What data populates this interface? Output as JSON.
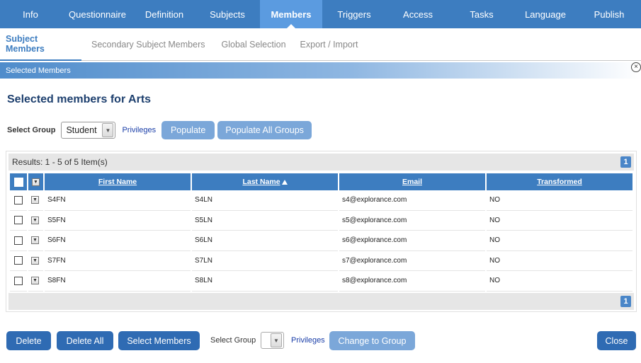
{
  "topnav": {
    "tabs": [
      {
        "label": "Info"
      },
      {
        "label": "Questionnaire"
      },
      {
        "label": "Definition"
      },
      {
        "label": "Subjects"
      },
      {
        "label": "Members"
      },
      {
        "label": "Triggers"
      },
      {
        "label": "Access"
      },
      {
        "label": "Tasks"
      },
      {
        "label": "Language"
      },
      {
        "label": "Publish"
      }
    ],
    "active": "Members"
  },
  "subnav": {
    "tabs": [
      {
        "label": "Subject Members"
      },
      {
        "label": "Secondary Subject Members"
      },
      {
        "label": "Global Selection"
      },
      {
        "label": "Export / Import"
      }
    ],
    "active": "Subject Members"
  },
  "section": {
    "title": "Selected Members"
  },
  "page": {
    "heading": "Selected members for Arts"
  },
  "toolbar": {
    "select_group_label": "Select Group",
    "group_value": "Student",
    "privileges_label": "Privileges",
    "populate_label": "Populate",
    "populate_all_label": "Populate All Groups"
  },
  "grid": {
    "results_text": "Results: 1 - 5 of 5 Item(s)",
    "page_number": "1",
    "columns": [
      "First Name",
      "Last Name",
      "Email",
      "Transformed"
    ],
    "sorted_column": "Last Name",
    "rows": [
      {
        "first": "S4FN",
        "last": "S4LN",
        "email": "s4@explorance.com",
        "transformed": "NO"
      },
      {
        "first": "S5FN",
        "last": "S5LN",
        "email": "s5@explorance.com",
        "transformed": "NO"
      },
      {
        "first": "S6FN",
        "last": "S6LN",
        "email": "s6@explorance.com",
        "transformed": "NO"
      },
      {
        "first": "S7FN",
        "last": "S7LN",
        "email": "s7@explorance.com",
        "transformed": "NO"
      },
      {
        "first": "S8FN",
        "last": "S8LN",
        "email": "s8@explorance.com",
        "transformed": "NO"
      }
    ]
  },
  "bottom": {
    "delete_label": "Delete",
    "delete_all_label": "Delete All",
    "select_members_label": "Select Members",
    "select_group_label": "Select Group",
    "group_value": "",
    "privileges_label": "Privileges",
    "change_group_label": "Change to Group",
    "close_label": "Close"
  },
  "colors": {
    "nav_bg": "#3d7dc0",
    "nav_active": "#5b9be0",
    "button_dark": "#2f6bb3",
    "button_light": "#7ba7d9",
    "heading": "#1d3f6e"
  },
  "icons": {
    "section_close": "close-circle-icon",
    "sort": "sort-ascending-icon",
    "row_menu": "chevron-down-icon"
  }
}
